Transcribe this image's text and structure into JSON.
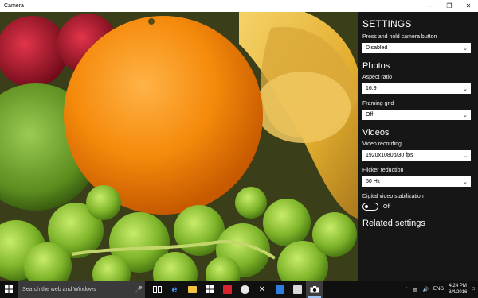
{
  "window": {
    "title": "Camera",
    "minimize_glyph": "—",
    "maximize_glyph": "❐",
    "close_glyph": "✕"
  },
  "settings": {
    "title": "SETTINGS",
    "camera_button": {
      "label": "Press and hold camera button",
      "value": "Disabled"
    },
    "photos": {
      "heading": "Photos",
      "aspect_ratio": {
        "label": "Aspect ratio",
        "value": "16:9"
      },
      "framing_grid": {
        "label": "Framing grid",
        "value": "Off"
      }
    },
    "videos": {
      "heading": "Videos",
      "video_recording": {
        "label": "Video recording",
        "value": "1920x1080p/30 fps"
      },
      "flicker_reduction": {
        "label": "Flicker reduction",
        "value": "50 Hz"
      },
      "stabilization": {
        "label": "Digital video stabilization",
        "state": "Off"
      }
    },
    "related_heading": "Related settings"
  },
  "taskbar": {
    "search_placeholder": "Search the web and Windows",
    "pinned_icons": [
      "task-view-icon",
      "edge-icon",
      "file-explorer-icon",
      "store-icon",
      "mail-icon",
      "groove-music-icon",
      "xbox-icon",
      "news-icon",
      "photos-icon",
      "camera-icon"
    ],
    "language": "ENG",
    "time": "4:24 PM",
    "date": "8/4/2016",
    "accent": "#9ec2ef"
  }
}
